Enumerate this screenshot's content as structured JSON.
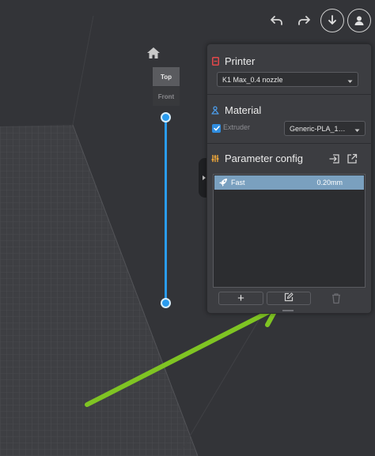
{
  "toolbar": {
    "undo_icon": "undo-arrow-icon",
    "redo_icon": "redo-arrow-icon",
    "download_icon": "download-arrow-icon",
    "account_icon": "user-icon"
  },
  "view_cube": {
    "home_icon": "home-icon",
    "top_label": "Top",
    "front_label": "Front"
  },
  "layer_slider": {
    "color": "#2a9cef",
    "upper_position": 1.0,
    "lower_position": 0.0
  },
  "panel": {
    "printer": {
      "title": "Printer",
      "icon": "printer-icon",
      "icon_color": "#e2484a",
      "selected": "K1 Max_0.4 nozzle"
    },
    "material": {
      "title": "Material",
      "icon": "material-icon",
      "icon_color": "#4c9be8",
      "extruder_label": "Extruder",
      "extruder_checked": true,
      "selected": "Generic-PLA_1…"
    },
    "parameter": {
      "title": "Parameter config",
      "icon": "parameter-sliders-icon",
      "icon_color": "#e8a33a",
      "import_icon": "import-icon",
      "export_icon": "export-icon",
      "profiles": [
        {
          "name": "Fast",
          "value": "0.20mm",
          "icon": "rocket-icon",
          "selected": true
        }
      ],
      "add_label": "+",
      "edit_icon": "edit-icon",
      "delete_icon": "trash-icon"
    }
  },
  "annotation": {
    "color": "#7fc423",
    "arrow_icon": "green-arrow-pointer"
  }
}
